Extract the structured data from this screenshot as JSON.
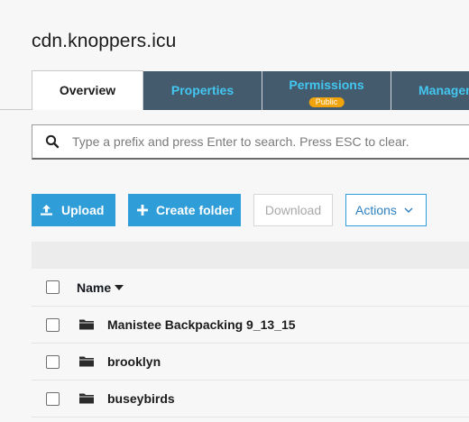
{
  "bucket": {
    "title": "cdn.knoppers.icu"
  },
  "tabs": [
    {
      "label": "Overview",
      "active": true
    },
    {
      "label": "Properties",
      "active": false
    },
    {
      "label": "Permissions",
      "active": false,
      "badge": "Public"
    },
    {
      "label": "Managem",
      "active": false
    }
  ],
  "search": {
    "placeholder": "Type a prefix and press Enter to search. Press ESC to clear.",
    "value": ""
  },
  "toolbar": {
    "upload_label": "Upload",
    "create_folder_label": "Create folder",
    "download_label": "Download",
    "actions_label": "Actions"
  },
  "table": {
    "name_header": "Name",
    "rows": [
      {
        "name": "Manistee Backpacking 9_13_15",
        "type": "folder"
      },
      {
        "name": "brooklyn",
        "type": "folder"
      },
      {
        "name": "buseybirds",
        "type": "folder"
      }
    ]
  },
  "colors": {
    "accent": "#2f9dd8",
    "tab_bg": "#445b6e",
    "tab_text": "#43c6f0",
    "badge": "#f0a30b"
  }
}
